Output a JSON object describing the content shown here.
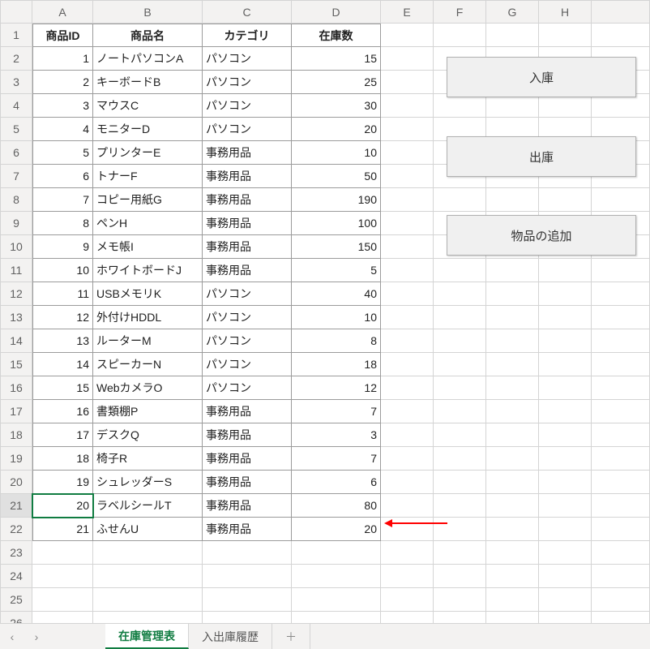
{
  "columns": [
    "A",
    "B",
    "C",
    "D",
    "E",
    "F",
    "G",
    "H"
  ],
  "headers": {
    "id": "商品ID",
    "name": "商品名",
    "category": "カテゴリ",
    "stock": "在庫数"
  },
  "rows": [
    {
      "id": 1,
      "name": "ノートパソコンA",
      "category": "パソコン",
      "stock": 15
    },
    {
      "id": 2,
      "name": "キーボードB",
      "category": "パソコン",
      "stock": 25
    },
    {
      "id": 3,
      "name": "マウスC",
      "category": "パソコン",
      "stock": 30
    },
    {
      "id": 4,
      "name": "モニターD",
      "category": "パソコン",
      "stock": 20
    },
    {
      "id": 5,
      "name": "プリンターE",
      "category": "事務用品",
      "stock": 10
    },
    {
      "id": 6,
      "name": "トナーF",
      "category": "事務用品",
      "stock": 50
    },
    {
      "id": 7,
      "name": "コピー用紙G",
      "category": "事務用品",
      "stock": 190
    },
    {
      "id": 8,
      "name": "ペンH",
      "category": "事務用品",
      "stock": 100
    },
    {
      "id": 9,
      "name": "メモ帳I",
      "category": "事務用品",
      "stock": 150
    },
    {
      "id": 10,
      "name": "ホワイトボードJ",
      "category": "事務用品",
      "stock": 5
    },
    {
      "id": 11,
      "name": "USBメモリK",
      "category": "パソコン",
      "stock": 40
    },
    {
      "id": 12,
      "name": "外付けHDDL",
      "category": "パソコン",
      "stock": 10
    },
    {
      "id": 13,
      "name": "ルーターM",
      "category": "パソコン",
      "stock": 8
    },
    {
      "id": 14,
      "name": "スピーカーN",
      "category": "パソコン",
      "stock": 18
    },
    {
      "id": 15,
      "name": "WebカメラO",
      "category": "パソコン",
      "stock": 12
    },
    {
      "id": 16,
      "name": "書類棚P",
      "category": "事務用品",
      "stock": 7
    },
    {
      "id": 17,
      "name": "デスクQ",
      "category": "事務用品",
      "stock": 3
    },
    {
      "id": 18,
      "name": "椅子R",
      "category": "事務用品",
      "stock": 7
    },
    {
      "id": 19,
      "name": "シュレッダーS",
      "category": "事務用品",
      "stock": 6
    },
    {
      "id": 20,
      "name": "ラベルシールT",
      "category": "事務用品",
      "stock": 80
    },
    {
      "id": 21,
      "name": "ふせんU",
      "category": "事務用品",
      "stock": 20
    }
  ],
  "empty_rows": 4,
  "selected_row_header": 21,
  "buttons": {
    "in": "入庫",
    "out": "出庫",
    "add": "物品の追加"
  },
  "tabs": {
    "active": "在庫管理表",
    "second": "入出庫履歴",
    "add": "＋"
  },
  "nav": {
    "prev": "‹",
    "next": "›"
  },
  "chart_data": {
    "type": "table",
    "title": "在庫管理表",
    "columns": [
      "商品ID",
      "商品名",
      "カテゴリ",
      "在庫数"
    ],
    "data": [
      [
        1,
        "ノートパソコンA",
        "パソコン",
        15
      ],
      [
        2,
        "キーボードB",
        "パソコン",
        25
      ],
      [
        3,
        "マウスC",
        "パソコン",
        30
      ],
      [
        4,
        "モニターD",
        "パソコン",
        20
      ],
      [
        5,
        "プリンターE",
        "事務用品",
        10
      ],
      [
        6,
        "トナーF",
        "事務用品",
        50
      ],
      [
        7,
        "コピー用紙G",
        "事務用品",
        190
      ],
      [
        8,
        "ペンH",
        "事務用品",
        100
      ],
      [
        9,
        "メモ帳I",
        "事務用品",
        150
      ],
      [
        10,
        "ホワイトボードJ",
        "事務用品",
        5
      ],
      [
        11,
        "USBメモリK",
        "パソコン",
        40
      ],
      [
        12,
        "外付けHDDL",
        "パソコン",
        10
      ],
      [
        13,
        "ルーターM",
        "パソコン",
        8
      ],
      [
        14,
        "スピーカーN",
        "パソコン",
        18
      ],
      [
        15,
        "WebカメラO",
        "パソコン",
        12
      ],
      [
        16,
        "書類棚P",
        "事務用品",
        7
      ],
      [
        17,
        "デスクQ",
        "事務用品",
        3
      ],
      [
        18,
        "椅子R",
        "事務用品",
        7
      ],
      [
        19,
        "シュレッダーS",
        "事務用品",
        6
      ],
      [
        20,
        "ラベルシールT",
        "事務用品",
        80
      ],
      [
        21,
        "ふせんU",
        "事務用品",
        20
      ]
    ]
  }
}
